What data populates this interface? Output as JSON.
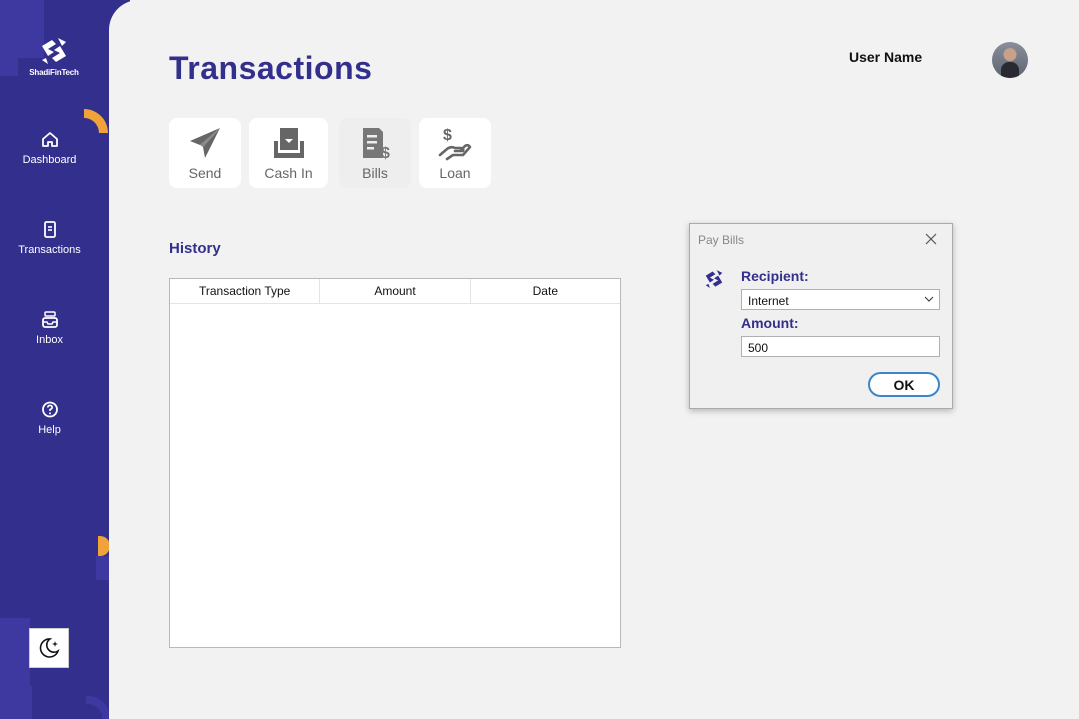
{
  "app": {
    "brand": "ShadiFinTech"
  },
  "sidebar": {
    "items": [
      {
        "label": "Dashboard",
        "icon": "home-icon"
      },
      {
        "label": "Transactions",
        "icon": "receipt-icon"
      },
      {
        "label": "Inbox",
        "icon": "inbox-icon"
      },
      {
        "label": "Help",
        "icon": "help-icon"
      }
    ],
    "theme_toggle_icon": "moon-icon"
  },
  "header": {
    "title": "Transactions",
    "user_name": "User Name"
  },
  "actions": [
    {
      "label": "Send",
      "icon": "paper-plane-icon",
      "enabled": true
    },
    {
      "label": "Cash In",
      "icon": "cash-in-icon",
      "enabled": true
    },
    {
      "label": "Bills",
      "icon": "bills-icon",
      "enabled": false
    },
    {
      "label": "Loan",
      "icon": "loan-icon",
      "enabled": true
    }
  ],
  "history": {
    "title": "History",
    "columns": [
      "Transaction Type",
      "Amount",
      "Date"
    ],
    "rows": []
  },
  "dialog": {
    "title": "Pay Bills",
    "recipient_label": "Recipient:",
    "recipient_value": "Internet",
    "amount_label": "Amount:",
    "amount_value": "500",
    "ok_label": "OK"
  },
  "colors": {
    "primary": "#332f8c",
    "accent": "#f0a33a",
    "ok_border": "#3b86c8"
  }
}
